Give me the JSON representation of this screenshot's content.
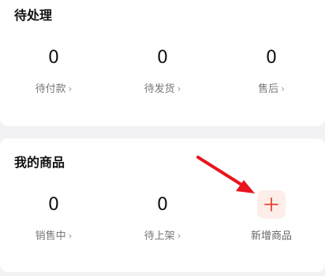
{
  "pending": {
    "title": "待处理",
    "stats": [
      {
        "value": "0",
        "label": "待付款"
      },
      {
        "value": "0",
        "label": "待发货"
      },
      {
        "value": "0",
        "label": "售后"
      }
    ]
  },
  "goods": {
    "title": "我的商品",
    "stats": [
      {
        "value": "0",
        "label": "销售中"
      },
      {
        "value": "0",
        "label": "待上架"
      }
    ],
    "add_label": "新增商品"
  },
  "chevron": "›",
  "colors": {
    "accent": "#e8432e",
    "add_bg": "#fdeeea",
    "annotation_arrow": "#e8141e"
  }
}
